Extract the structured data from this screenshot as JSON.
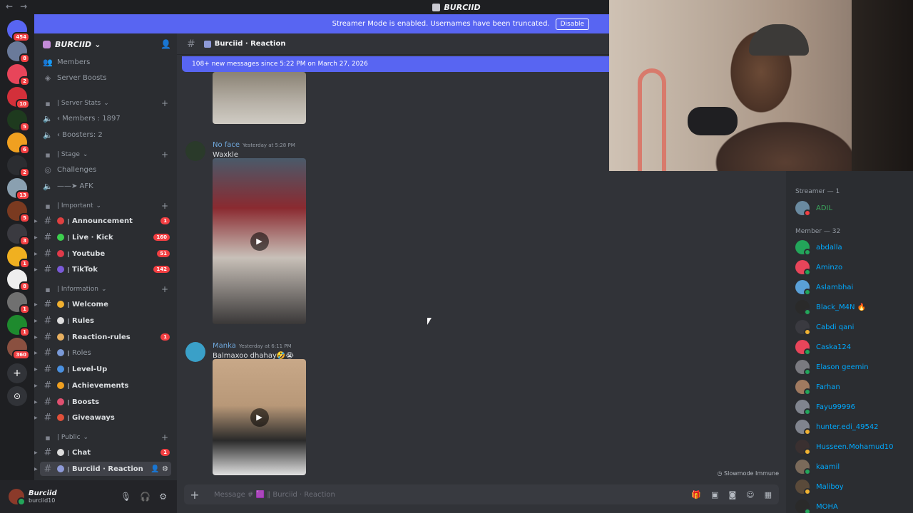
{
  "titlebar": {
    "title": "BURCIID",
    "back": "←",
    "forward": "→"
  },
  "banner": {
    "text": "Streamer Mode is enabled. Usernames have been truncated.",
    "button": "Disable"
  },
  "rail": {
    "servers": [
      {
        "badge": "454",
        "color": "#5865f2"
      },
      {
        "badge": "8",
        "color": "#6a7a9a"
      },
      {
        "badge": "2",
        "color": "#e8455a"
      },
      {
        "badge": "10",
        "color": "#d3303a"
      },
      {
        "badge": "5",
        "color": "#1e3a1e"
      },
      {
        "badge": "6",
        "color": "#f0a020"
      },
      {
        "badge": "2",
        "color": "#2b2d31"
      },
      {
        "badge": "13",
        "color": "#8aa0b0"
      },
      {
        "badge": "5",
        "color": "#7a3a20"
      },
      {
        "badge": "3",
        "color": "#3a3a40"
      },
      {
        "badge": "1",
        "color": "#f0b020"
      },
      {
        "badge": "8",
        "color": "#eeeeee"
      },
      {
        "badge": "1",
        "color": "#707070"
      },
      {
        "badge": "1",
        "color": "#1e8a2e"
      },
      {
        "badge": "360",
        "color": "#8a5040"
      }
    ],
    "add_icon": "+",
    "discover_icon": "⊙"
  },
  "sidebar": {
    "guild_name": "BURCIID",
    "items": [
      {
        "kind": "item",
        "label": "Members",
        "glyph": "👥"
      },
      {
        "kind": "item",
        "label": "Server Boosts",
        "glyph": "◈"
      },
      {
        "kind": "cat",
        "label": "| Server Stats"
      },
      {
        "kind": "voice",
        "label": "‹ Members : 1897"
      },
      {
        "kind": "voice",
        "label": "‹ Boosters: 2"
      },
      {
        "kind": "cat",
        "label": "| Stage"
      },
      {
        "kind": "item",
        "label": "Challenges",
        "glyph": "◎"
      },
      {
        "kind": "voice",
        "label": "——➤ AFK"
      },
      {
        "kind": "cat",
        "label": "| Important"
      },
      {
        "kind": "ch",
        "label": "Announcement",
        "emo": "#e04040",
        "unread": "1"
      },
      {
        "kind": "ch",
        "label": "Live · Kick",
        "emo": "#3ccf4e",
        "unread": "160"
      },
      {
        "kind": "ch",
        "label": "Youtube",
        "emo": "#e03a4a",
        "unread": "51"
      },
      {
        "kind": "ch",
        "label": "TikTok",
        "emo": "#7a5ad8",
        "unread": "142"
      },
      {
        "kind": "cat",
        "label": "| Information"
      },
      {
        "kind": "ch",
        "label": "Welcome",
        "emo": "#f0b030"
      },
      {
        "kind": "ch",
        "label": "Rules",
        "emo": "#dddddd"
      },
      {
        "kind": "ch",
        "label": "Reaction-rules",
        "emo": "#e8b060",
        "unread": "1"
      },
      {
        "kind": "ch",
        "label": "Roles",
        "emo": "#7a9ad8",
        "dim": true
      },
      {
        "kind": "ch",
        "label": "Level-Up",
        "emo": "#4a90e0"
      },
      {
        "kind": "ch",
        "label": "Achievements",
        "emo": "#f0a020"
      },
      {
        "kind": "ch",
        "label": "Boosts",
        "emo": "#e05070"
      },
      {
        "kind": "ch",
        "label": "Giveaways",
        "emo": "#e0503a"
      },
      {
        "kind": "cat",
        "label": "| Public"
      },
      {
        "kind": "ch",
        "label": "Chat",
        "emo": "#dddddd",
        "unread": "1"
      },
      {
        "kind": "ch",
        "label": "Burciid · Reaction",
        "emo": "#8e9ad8",
        "active": true
      }
    ]
  },
  "user": {
    "name": "Burciid",
    "tag": "burciid10"
  },
  "chat": {
    "channel": "Burciid · Reaction",
    "new_messages": "108+ new messages since 5:22 PM on March 27, 2026",
    "messages": [
      {
        "author": "No face",
        "color": "#6fa8dc",
        "time": "Yesterday at 5:28 PM",
        "text": "Waxkle",
        "avatar": "#2a3a2a"
      },
      {
        "author": "Manka",
        "color": "#6fa8dc",
        "time": "Yesterday at 6:11 PM",
        "text": "Balmaxoo dhahay🤣😭",
        "avatar": "#3aa0c8"
      }
    ],
    "slowmode": "Slowmode Immune",
    "composer_placeholder": "Message # 🟪 ‖ Burciid · Reaction",
    "play_icon": "▶"
  },
  "members": {
    "streamer_header": "Streamer — 1",
    "streamer": {
      "name": "ADIL",
      "color": "#3ba55c",
      "avatar": "#6a8aa0",
      "status": "#f23f42"
    },
    "member_header": "Member — 32",
    "list": [
      {
        "name": "abdalla",
        "avatar": "#23a55a",
        "status": "#23a55a"
      },
      {
        "name": "Aminzo",
        "avatar": "#e8455a",
        "status": "#23a55a"
      },
      {
        "name": "Aslambhai",
        "avatar": "#5aa0d8",
        "status": "#23a55a"
      },
      {
        "name": "Black_M4N 🔥",
        "avatar": "#2a2a2a",
        "status": "#23a55a"
      },
      {
        "name": "Cabdi qani",
        "avatar": "#3a3a40",
        "status": "#f0b232"
      },
      {
        "name": "Caska124",
        "avatar": "#e8455a",
        "status": "#23a55a"
      },
      {
        "name": "Elason geemin",
        "avatar": "#7a7a80",
        "status": "#23a55a"
      },
      {
        "name": "Farhan",
        "avatar": "#a07a60",
        "status": "#23a55a"
      },
      {
        "name": "Fayu99996",
        "avatar": "#80848e",
        "status": "#23a55a"
      },
      {
        "name": "hunter.edi_49542",
        "avatar": "#80848e",
        "status": "#f0b232"
      },
      {
        "name": "Husseen.Mohamud10",
        "avatar": "#3a3030",
        "status": "#f0b232"
      },
      {
        "name": "kaamil",
        "avatar": "#7a6a5a",
        "status": "#23a55a"
      },
      {
        "name": "Maliboy",
        "avatar": "#5a4a3a",
        "status": "#f0b232"
      },
      {
        "name": "MOHA",
        "avatar": "#2a2a2a",
        "status": "#23a55a"
      }
    ]
  }
}
